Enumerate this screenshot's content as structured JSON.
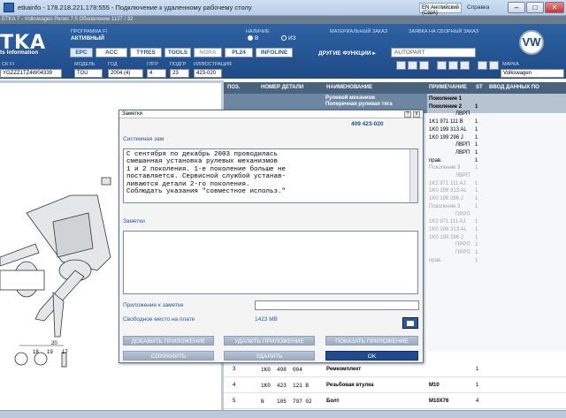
{
  "rdp": {
    "title": "etkainfo - 178.218.221.178:555 - Подключение к удаленному рабочему столу",
    "lang": "EN Английский (США)",
    "help": "Справка"
  },
  "app": {
    "subtitle": "ETKA 7 - Volkswagen Релиз 7.5 Обновление 1137 / 32",
    "logo": "TKA",
    "logo_sub": "ts Information",
    "prog_label": "ПРОГРАММА FI",
    "prog_value": "АКТИВНЫЙ",
    "avail_label": "НАЛИЧИЕ",
    "radio_b": "В",
    "radio_iz": "ИЗ",
    "material_order": "МАТЕРИАЛЬНЫЙ ЗАКАЗ",
    "assembly_order": "ЗАЯВКА НА СБОРНЫЙ ЗАКАЗ",
    "tabs": [
      "EPC",
      "ACC",
      "TYRES",
      "TOOLS",
      "NORA",
      "PL24",
      "INFOLINE"
    ],
    "other_functions": "ДРУГИЕ ФУНКЦИИ ▸",
    "autopart": "AUTOPART",
    "brand_label": "МАРКА",
    "brand_value": "Volkswagen",
    "vw_logo": "VW"
  },
  "filter": {
    "vin_label": "CK FI",
    "vin": "YGZZZ1TZ4W04339",
    "model_label": "МОДЕЛЬ",
    "model": "TOU",
    "year_label": "ГОД",
    "year": "2004 (4)",
    "group_label": "ГЛГР",
    "group": "4",
    "subgroup_label": "ПОДГР",
    "subgroup": "23",
    "illus_label": "ИЛЛЮСТРАЦИЯ",
    "illus": "423-020"
  },
  "table": {
    "headers": [
      "ПОЗ.",
      "НОМЕР ДЕТАЛИ",
      "НАИМЕНОВАНИЕ",
      "ПРИМЕЧАНИЕ",
      "ST",
      "ВВОД ДАННЫХ ПО"
    ],
    "top_desc": [
      "Рулевой механизм",
      "Поперечная рулевая тяга"
    ],
    "notes": [
      {
        "t": "Поколение 1",
        "b": true
      },
      {
        "t": "Поколение 2",
        "st": "1",
        "b": true
      },
      {
        "t": "ЛВРП"
      },
      {
        "t": "1K1 971 111 B",
        "st": "1"
      },
      {
        "t": "1K0 199 313 AL",
        "st": "1"
      },
      {
        "t": "1K0 199 296 J",
        "st": "1"
      },
      {
        "t": "ЛВРП",
        "st": "1"
      },
      {
        "t": "ЛВРП",
        "st": "1"
      },
      {
        "t": "прав.",
        "st": "1"
      },
      {
        "t": "Поколение 3",
        "st": "1",
        "g": true
      },
      {
        "t": "ЛВРП",
        "g": true
      },
      {
        "t": "1K2 971 111 AJ",
        "st": "1",
        "g": true
      },
      {
        "t": "1K0 199 313 AL",
        "st": "1",
        "g": true
      },
      {
        "t": "1K0 199 296 J",
        "st": "1",
        "g": true
      },
      {
        "t": "Поколение 3",
        "st": "1",
        "g": true
      },
      {
        "t": "ПРРП",
        "g": true
      },
      {
        "t": "1K2 971 111 AJ",
        "st": "1",
        "g": true
      },
      {
        "t": "1K0 199 313 AL",
        "st": "1",
        "g": true
      },
      {
        "t": "1K0 199 296 J",
        "st": "1",
        "g": true
      },
      {
        "t": "ПРРП",
        "st": "1",
        "g": true
      },
      {
        "t": "ПРРП",
        "st": "1",
        "g": true
      },
      {
        "t": "прав.",
        "st": "1",
        "g": true
      }
    ],
    "rows": [
      {
        "pos": "3",
        "part": "1K0  498  004",
        "name": "Ремкомплект",
        "note": "",
        "st": "1"
      },
      {
        "pos": "4",
        "part": "1K0  423  121 B",
        "name": "Резьбовая втулка",
        "note": "M10",
        "st": "1"
      },
      {
        "pos": "5",
        "part": "N    105  797 02",
        "name": "Болт",
        "note": "M10X76",
        "st": "4"
      }
    ]
  },
  "dialog": {
    "title": "Заметки",
    "part_number": "409 423-020",
    "system_label": "Системная зам",
    "system_text": "С сентября по декабрь 2003 проводилась\nсмешанная установка рулевых механизмов\n1 и 2 поколения. 1-е поколение больше не\nпоставляется. Сервисной службой устанав-\nливаются детали 2-го поколения.\nСоблюдать указания \"совместное использ.\"",
    "notes_label": "Заметки",
    "notes_text": "",
    "attach_label": "Приложение к заметке",
    "attach_value": "",
    "free_label": "Свободное место на плате",
    "free_value": "1423 MB",
    "btn_add": "ДОБАВИТЬ ПРИЛОЖЕНИЕ",
    "btn_del": "УДАЛИТЬ ПРИЛОЖЕНИЕ",
    "btn_show": "ПОКАЗАТЬ ПРИЛОЖЕНИЕ",
    "btn_save": "СОХРАНИТЬ",
    "btn_remove": "УДАЛИТЬ",
    "btn_ok": "OK"
  },
  "illustration": {
    "callouts": [
      "20",
      "18",
      "19",
      "17",
      "15"
    ]
  },
  "colors": {
    "header_blue": "#1e4a86",
    "table_header": "#49637f",
    "ok_blue": "#1d4a91",
    "label_blue": "#2a54a3"
  }
}
